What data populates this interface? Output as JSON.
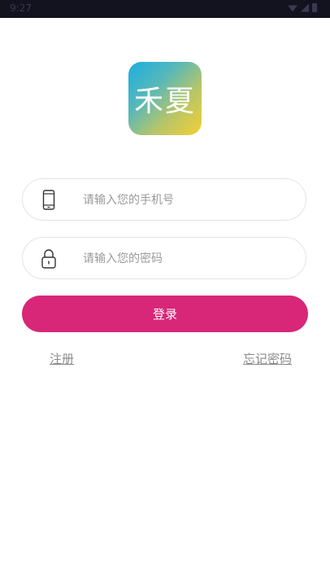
{
  "status_bar": {
    "time": "9:27"
  },
  "logo": {
    "text": "禾夏"
  },
  "form": {
    "phone_placeholder": "请输入您的手机号",
    "password_placeholder": "请输入您的密码"
  },
  "actions": {
    "login_label": "登录",
    "register_label": "注册",
    "forgot_label": "忘记密码"
  },
  "colors": {
    "primary": "#d82678",
    "status_bar": "#13121f",
    "link": "#8a8a8a"
  }
}
